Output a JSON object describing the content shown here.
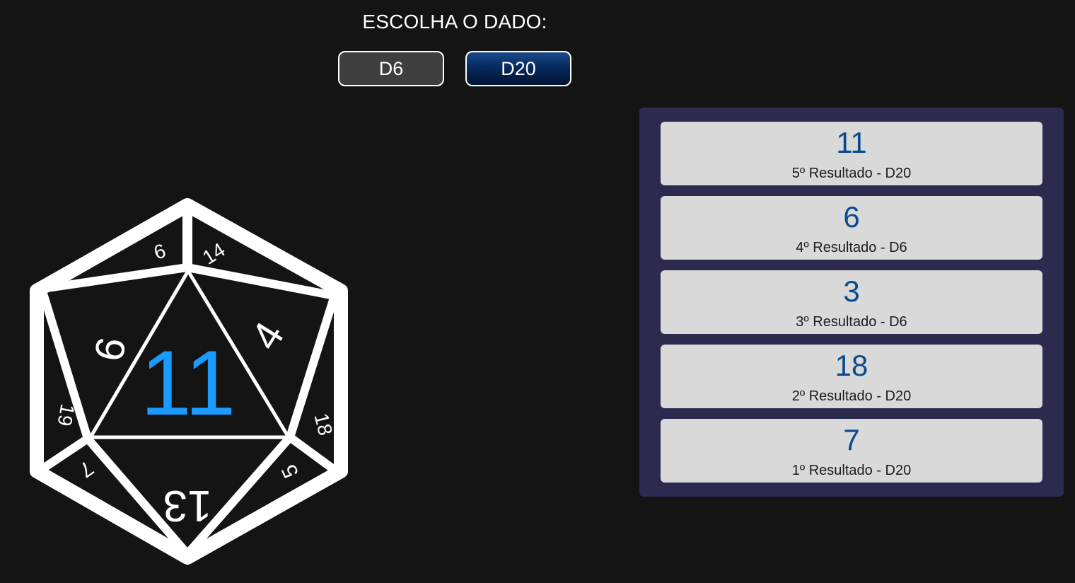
{
  "header": {
    "title": "ESCOLHA O DADO:"
  },
  "dice_buttons": [
    {
      "label": "D6",
      "selected": false
    },
    {
      "label": "D20",
      "selected": true
    }
  ],
  "die": {
    "type": "D20",
    "result": "11",
    "face_numbers": [
      "6",
      "14",
      "9",
      "4",
      "19",
      "18",
      "7",
      "13",
      "5"
    ],
    "result_color": "#1a9bff",
    "outline_color": "#ffffff"
  },
  "results": [
    {
      "value": "11",
      "label": "5º Resultado - D20"
    },
    {
      "value": "6",
      "label": "4º Resultado - D6"
    },
    {
      "value": "3",
      "label": "3º Resultado - D6"
    },
    {
      "value": "18",
      "label": "2º Resultado - D20"
    },
    {
      "value": "7",
      "label": "1º Resultado - D20"
    }
  ],
  "colors": {
    "background": "#141414",
    "panel": "#2c2a4f",
    "card": "#d9d9d9",
    "result_value": "#0a4a8c",
    "selected_button": "#062a5e",
    "unselected_button": "#3f3f3f"
  }
}
